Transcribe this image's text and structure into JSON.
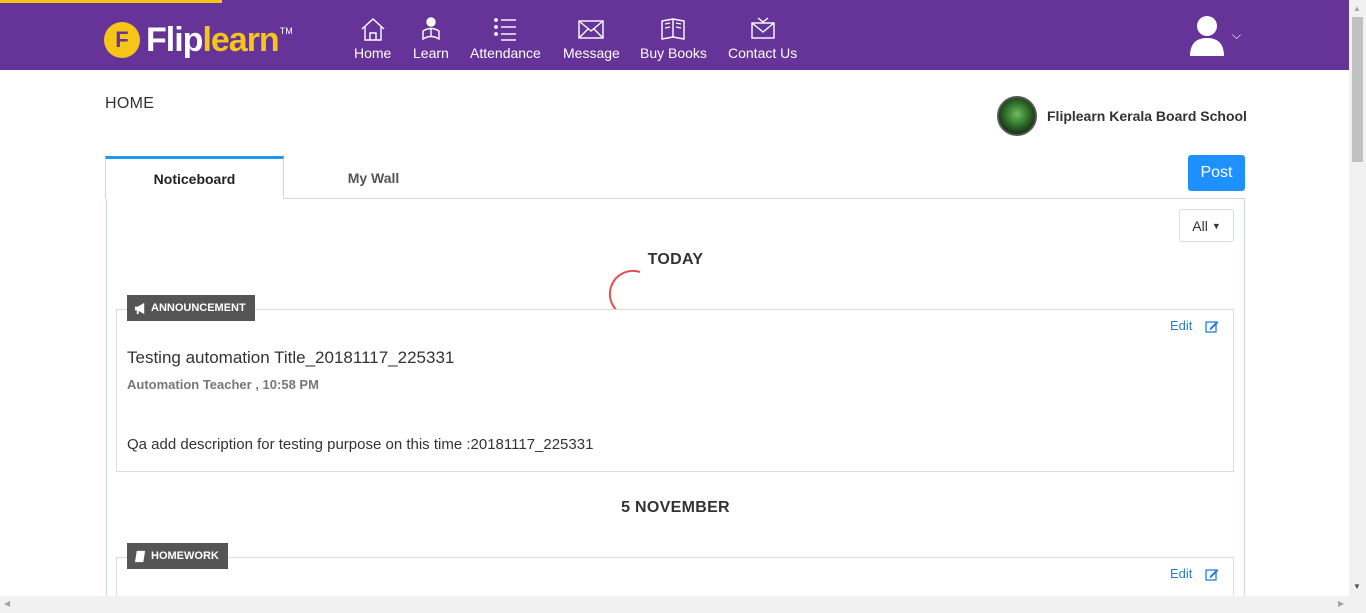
{
  "brand": {
    "logo_badge": "F",
    "logo_word_1": "Flip",
    "logo_word_2": "learn",
    "logo_tm": "TM",
    "color_primary": "#663399",
    "color_accent": "#f5c518"
  },
  "nav": {
    "items": [
      {
        "label": "Home",
        "icon": "home-icon"
      },
      {
        "label": "Learn",
        "icon": "learn-icon"
      },
      {
        "label": "Attendance",
        "icon": "attendance-icon"
      },
      {
        "label": "Message",
        "icon": "message-icon"
      },
      {
        "label": "Buy Books",
        "icon": "books-icon"
      },
      {
        "label": "Contact Us",
        "icon": "contact-icon"
      }
    ],
    "user_icon": "user-avatar-icon",
    "user_menu_icon": "chevron-down-icon"
  },
  "page": {
    "title": "HOME",
    "school_name": "Fliplearn Kerala Board School"
  },
  "tabs": [
    {
      "label": "Noticeboard",
      "active": true
    },
    {
      "label": "My Wall",
      "active": false
    }
  ],
  "post_button": "Post",
  "filter": {
    "selected": "All"
  },
  "feed": [
    {
      "day": "TODAY",
      "tag": "ANNOUNCEMENT",
      "tag_icon": "megaphone-icon",
      "edit_label": "Edit",
      "title": "Testing automation Title_20181117_225331",
      "meta": "Automation Teacher , 10:58 PM",
      "description": "Qa add description for testing purpose on this time :20181117_225331"
    },
    {
      "day": "5 NOVEMBER",
      "tag": "HOMEWORK",
      "tag_icon": "book-icon",
      "edit_label": "Edit"
    }
  ],
  "link_color": "#2a7fd4",
  "button_color": "#1e90ff"
}
